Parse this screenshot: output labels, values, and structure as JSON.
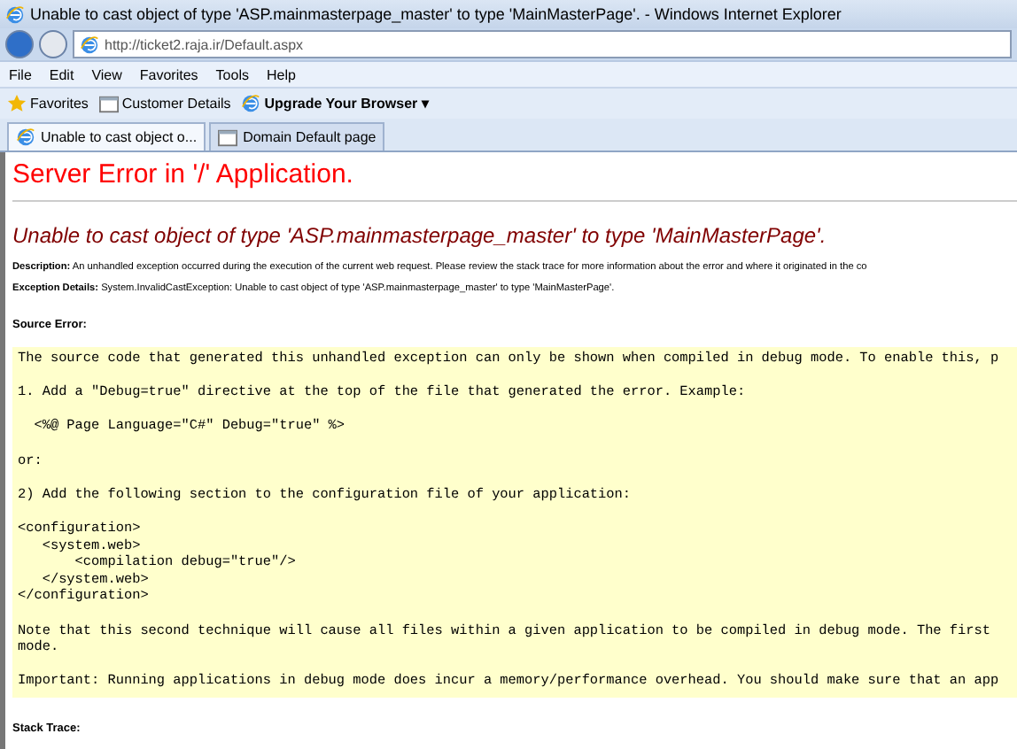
{
  "window": {
    "title": "Unable to cast object of type 'ASP.mainmasterpage_master' to type 'MainMasterPage'. - Windows Internet Explorer"
  },
  "address_bar": {
    "value": "http://ticket2.raja.ir/Default.aspx"
  },
  "menu": [
    "File",
    "Edit",
    "View",
    "Favorites",
    "Tools",
    "Help"
  ],
  "favorites_bar": [
    {
      "kind": "favorites",
      "label": "Favorites"
    },
    {
      "kind": "page",
      "label": "Customer Details"
    },
    {
      "kind": "ie",
      "label": "Upgrade Your Browser ▾"
    }
  ],
  "tabs": [
    {
      "label": "Unable to cast object o...",
      "selected": true
    },
    {
      "label": "Domain Default page",
      "selected": false
    }
  ],
  "page": {
    "heading": "Server Error in '/' Application.",
    "error_title": "Unable to cast object of type 'ASP.mainmasterpage_master' to type 'MainMasterPage'.",
    "details": [
      {
        "label": "Description:",
        "text": "An unhandled exception occurred during the execution of the current web request. Please review the stack trace for more information about the error and where it originated in the co"
      },
      {
        "label": "Exception Details:",
        "text": "System.InvalidCastException: Unable to cast object of type 'ASP.mainmasterpage_master' to type 'MainMasterPage'."
      }
    ],
    "source_error_label": "Source Error:",
    "source_error_paragraphs": [
      [
        "The source code that generated this unhandled exception can only be shown when compiled in debug mode. To enable this, p"
      ],
      [
        "1. Add a \"Debug=true\" directive at the top of the file that generated the error. Example:"
      ],
      [
        "  <%@ Page Language=\"C#\" Debug=\"true\" %>"
      ],
      [
        "or:"
      ],
      [
        "2) Add the following section to the configuration file of your application:"
      ],
      [
        "<configuration>",
        "   <system.web>",
        "       <compilation debug=\"true\"/>",
        "   </system.web>",
        "</configuration>"
      ],
      [
        "Note that this second technique will cause all files within a given application to be compiled in debug mode. The first",
        "mode."
      ],
      [
        "Important: Running applications in debug mode does incur a memory/performance overhead. You should make sure that an app"
      ]
    ],
    "stack_trace_label": "Stack Trace:"
  }
}
